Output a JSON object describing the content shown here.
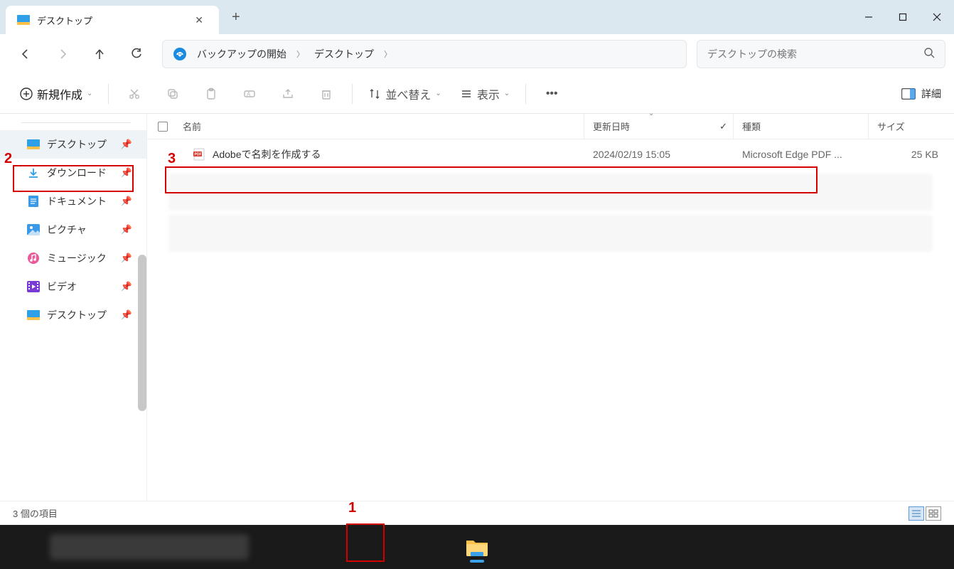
{
  "window": {
    "title": "デスクトップ"
  },
  "breadcrumb": {
    "root": "バックアップの開始",
    "current": "デスクトップ"
  },
  "search": {
    "placeholder": "デスクトップの検索"
  },
  "toolbar": {
    "new_label": "新規作成",
    "sort_label": "並べ替え",
    "view_label": "表示",
    "detail_label": "詳細"
  },
  "columns": {
    "name": "名前",
    "date": "更新日時",
    "type": "種類",
    "size": "サイズ"
  },
  "sidebar": {
    "items": [
      {
        "label": "デスクトップ",
        "icon": "desktop",
        "selected": true
      },
      {
        "label": "ダウンロード",
        "icon": "download",
        "selected": false
      },
      {
        "label": "ドキュメント",
        "icon": "document",
        "selected": false
      },
      {
        "label": "ピクチャ",
        "icon": "picture",
        "selected": false
      },
      {
        "label": "ミュージック",
        "icon": "music",
        "selected": false
      },
      {
        "label": "ビデオ",
        "icon": "video",
        "selected": false
      },
      {
        "label": "デスクトップ",
        "icon": "desktop",
        "selected": false
      }
    ]
  },
  "files": [
    {
      "name": "Adobeで名刺を作成する",
      "date": "2024/02/19 15:05",
      "type": "Microsoft Edge PDF ...",
      "size": "25 KB"
    }
  ],
  "status": {
    "text": "3 個の項目"
  },
  "annotations": {
    "one": "1",
    "two": "2",
    "three": "3"
  }
}
